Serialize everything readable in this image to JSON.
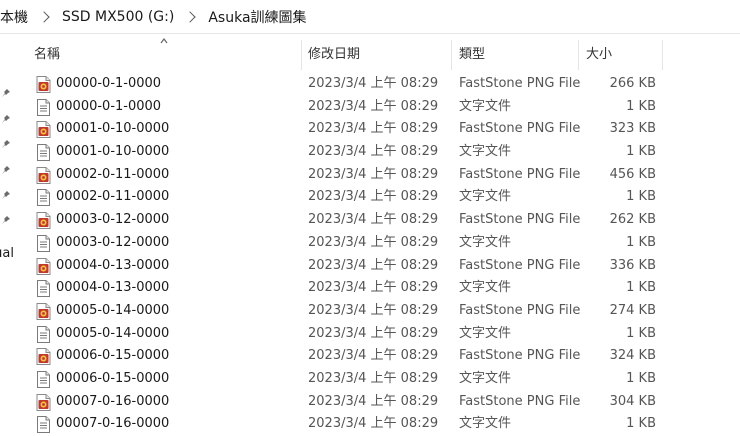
{
  "breadcrumb": {
    "items": [
      "本機",
      "SSD MX500 (G:)",
      "Asuka訓練圖集"
    ]
  },
  "nav": {
    "partial_label": "ual"
  },
  "columns": {
    "name": "名稱",
    "date": "修改日期",
    "type": "類型",
    "size": "大小"
  },
  "files": [
    {
      "name": "00000-0-1-0000",
      "date": "2023/3/4 上午 08:29",
      "type": "FastStone PNG File",
      "size": "266 KB",
      "icon": "png-file-icon"
    },
    {
      "name": "00000-0-1-0000",
      "date": "2023/3/4 上午 08:29",
      "type": "文字文件",
      "size": "1 KB",
      "icon": "text-file-icon"
    },
    {
      "name": "00001-0-10-0000",
      "date": "2023/3/4 上午 08:29",
      "type": "FastStone PNG File",
      "size": "323 KB",
      "icon": "png-file-icon"
    },
    {
      "name": "00001-0-10-0000",
      "date": "2023/3/4 上午 08:29",
      "type": "文字文件",
      "size": "1 KB",
      "icon": "text-file-icon"
    },
    {
      "name": "00002-0-11-0000",
      "date": "2023/3/4 上午 08:29",
      "type": "FastStone PNG File",
      "size": "456 KB",
      "icon": "png-file-icon"
    },
    {
      "name": "00002-0-11-0000",
      "date": "2023/3/4 上午 08:29",
      "type": "文字文件",
      "size": "1 KB",
      "icon": "text-file-icon"
    },
    {
      "name": "00003-0-12-0000",
      "date": "2023/3/4 上午 08:29",
      "type": "FastStone PNG File",
      "size": "262 KB",
      "icon": "png-file-icon"
    },
    {
      "name": "00003-0-12-0000",
      "date": "2023/3/4 上午 08:29",
      "type": "文字文件",
      "size": "1 KB",
      "icon": "text-file-icon"
    },
    {
      "name": "00004-0-13-0000",
      "date": "2023/3/4 上午 08:29",
      "type": "FastStone PNG File",
      "size": "336 KB",
      "icon": "png-file-icon"
    },
    {
      "name": "00004-0-13-0000",
      "date": "2023/3/4 上午 08:29",
      "type": "文字文件",
      "size": "1 KB",
      "icon": "text-file-icon"
    },
    {
      "name": "00005-0-14-0000",
      "date": "2023/3/4 上午 08:29",
      "type": "FastStone PNG File",
      "size": "274 KB",
      "icon": "png-file-icon"
    },
    {
      "name": "00005-0-14-0000",
      "date": "2023/3/4 上午 08:29",
      "type": "文字文件",
      "size": "1 KB",
      "icon": "text-file-icon"
    },
    {
      "name": "00006-0-15-0000",
      "date": "2023/3/4 上午 08:29",
      "type": "FastStone PNG File",
      "size": "324 KB",
      "icon": "png-file-icon"
    },
    {
      "name": "00006-0-15-0000",
      "date": "2023/3/4 上午 08:29",
      "type": "文字文件",
      "size": "1 KB",
      "icon": "text-file-icon"
    },
    {
      "name": "00007-0-16-0000",
      "date": "2023/3/4 上午 08:29",
      "type": "FastStone PNG File",
      "size": "304 KB",
      "icon": "png-file-icon"
    },
    {
      "name": "00007-0-16-0000",
      "date": "2023/3/4 上午 08:29",
      "type": "文字文件",
      "size": "1 KB",
      "icon": "text-file-icon"
    }
  ]
}
